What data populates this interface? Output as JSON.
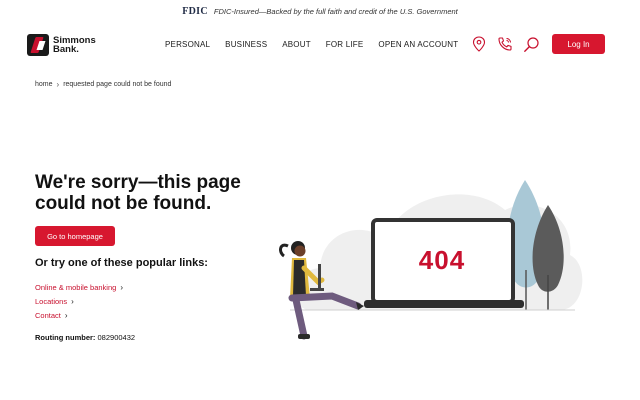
{
  "fdic": {
    "logo": "FDIC",
    "text": "FDIC-Insured—Backed by the full faith and credit of the U.S. Government"
  },
  "header": {
    "brand_line1": "Simmons",
    "brand_line2": "Bank.",
    "nav": [
      "PERSONAL",
      "BUSINESS",
      "ABOUT",
      "FOR LIFE",
      "OPEN AN ACCOUNT"
    ],
    "login_label": "Log In",
    "icons": [
      "location-pin-icon",
      "phone-icon",
      "search-icon"
    ]
  },
  "breadcrumb": {
    "home": "home",
    "current": "requested page could not be found"
  },
  "main": {
    "heading": "We're sorry—this page could not be found.",
    "home_button": "Go to homepage",
    "popular_heading": "Or try one of these popular links:",
    "links": [
      "Online & mobile banking",
      "Locations",
      "Contact"
    ],
    "routing_label": "Routing number:",
    "routing_value": "082900432"
  },
  "illustration": {
    "error_code": "404"
  },
  "colors": {
    "brand_red": "#d7172f",
    "text_dark": "#111111"
  }
}
